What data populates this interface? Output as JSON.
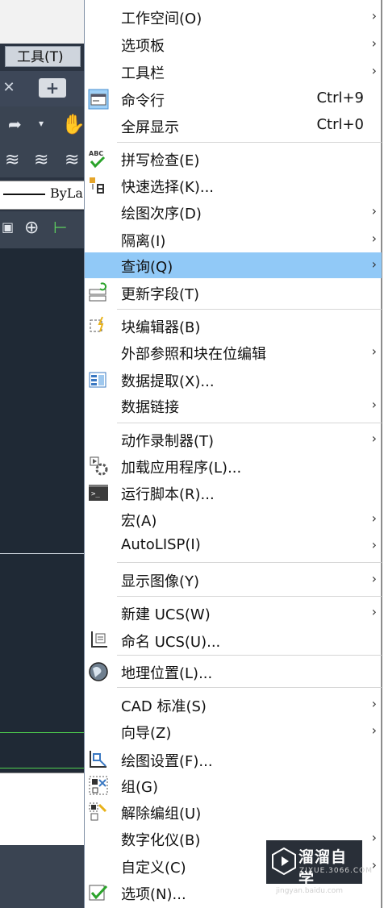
{
  "background": {
    "tool_menu": "工具(T)",
    "tab_close": "✕",
    "tab_add": "+",
    "bylayer": "ByLa"
  },
  "menu": {
    "items": [
      {
        "label": "工作空间(O)",
        "submenu": true,
        "icon": "none"
      },
      {
        "label": "选项板",
        "submenu": true,
        "icon": "none"
      },
      {
        "label": "工具栏",
        "submenu": true,
        "icon": "none"
      },
      {
        "label": "命令行",
        "shortcut": "Ctrl+9",
        "icon": "command-line-icon",
        "checked": true
      },
      {
        "label": "全屏显示",
        "shortcut": "Ctrl+0",
        "icon": "none"
      },
      {
        "label": "拼写检查(E)",
        "icon": "spell-check-icon"
      },
      {
        "label": "快速选择(K)...",
        "icon": "quick-select-icon"
      },
      {
        "label": "绘图次序(D)",
        "submenu": true,
        "icon": "none"
      },
      {
        "label": "隔离(I)",
        "submenu": true,
        "icon": "none"
      },
      {
        "label": "查询(Q)",
        "submenu": true,
        "icon": "none",
        "highlighted": true
      },
      {
        "label": "更新字段(T)",
        "icon": "update-field-icon"
      },
      {
        "label": "块编辑器(B)",
        "icon": "block-editor-icon"
      },
      {
        "label": "外部参照和块在位编辑",
        "submenu": true,
        "icon": "none"
      },
      {
        "label": "数据提取(X)...",
        "icon": "data-extraction-icon"
      },
      {
        "label": "数据链接",
        "submenu": true,
        "icon": "none"
      },
      {
        "label": "动作录制器(T)",
        "submenu": true,
        "icon": "none"
      },
      {
        "label": "加载应用程序(L)...",
        "icon": "load-application-icon"
      },
      {
        "label": "运行脚本(R)...",
        "icon": "run-script-icon"
      },
      {
        "label": "宏(A)",
        "submenu": true,
        "icon": "none"
      },
      {
        "label": "AutoLISP(I)",
        "submenu": true,
        "icon": "none"
      },
      {
        "label": "显示图像(Y)",
        "submenu": true,
        "icon": "none"
      },
      {
        "label": "新建 UCS(W)",
        "submenu": true,
        "icon": "none"
      },
      {
        "label": "命名 UCS(U)...",
        "icon": "named-ucs-icon"
      },
      {
        "label": "地理位置(L)...",
        "icon": "geolocation-globe-icon"
      },
      {
        "label": "CAD 标准(S)",
        "submenu": true,
        "icon": "none"
      },
      {
        "label": "向导(Z)",
        "submenu": true,
        "icon": "none"
      },
      {
        "label": "绘图设置(F)...",
        "icon": "drafting-settings-icon"
      },
      {
        "label": "组(G)",
        "icon": "group-icon"
      },
      {
        "label": "解除编组(U)",
        "icon": "ungroup-icon"
      },
      {
        "label": "数字化仪(B)",
        "submenu": true,
        "icon": "none"
      },
      {
        "label": "自定义(C)",
        "submenu": true,
        "icon": "none"
      },
      {
        "label": "选项(N)...",
        "icon": "options-check-icon"
      }
    ],
    "arrow_glyph": "›"
  },
  "watermark": {
    "title": "溜溜自学",
    "url": "ZIXUE.3066.COM",
    "url2": "jingyan.baidu.com"
  },
  "colors": {
    "highlight": "#91c9f7",
    "app_dark": "#2b3442"
  }
}
